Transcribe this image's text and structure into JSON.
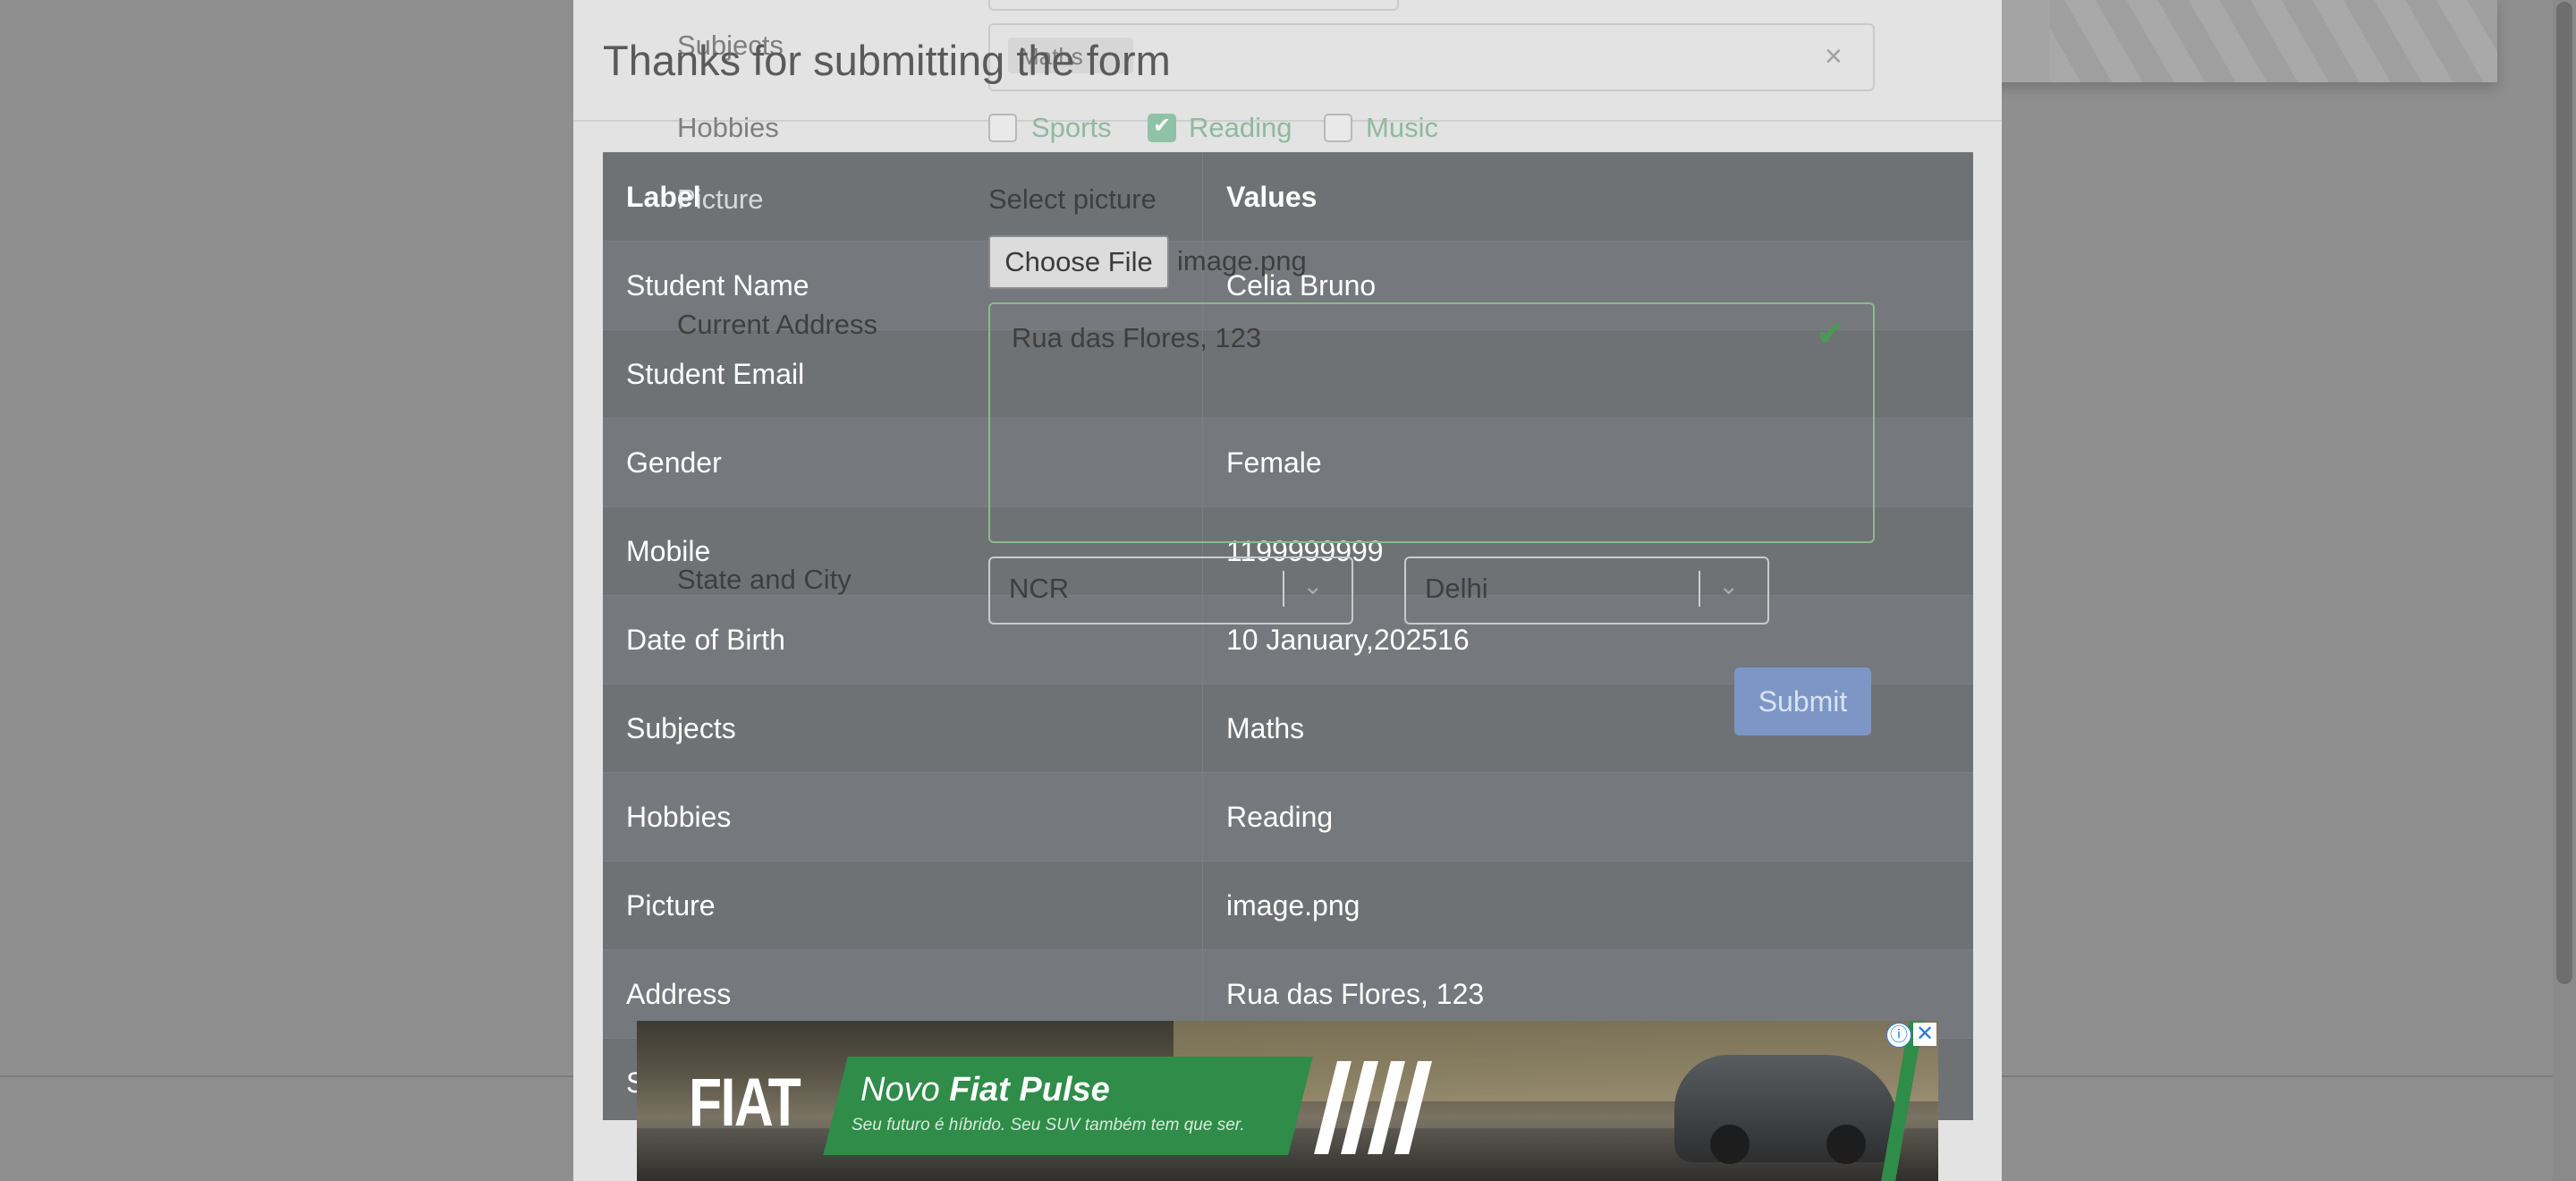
{
  "modal": {
    "title": "Thanks for submitting the form"
  },
  "table": {
    "headers": [
      "Label",
      "Values"
    ],
    "rows": [
      [
        "Student Name",
        "Celia Bruno"
      ],
      [
        "Student Email",
        ""
      ],
      [
        "Gender",
        "Female"
      ],
      [
        "Mobile",
        "1199999999"
      ],
      [
        "Date of Birth",
        "10 January,202516"
      ],
      [
        "Subjects",
        "Maths"
      ],
      [
        "Hobbies",
        "Reading"
      ],
      [
        "Picture",
        "image.png"
      ],
      [
        "Address",
        "Rua das Flores, 123"
      ],
      [
        "S",
        ""
      ]
    ]
  },
  "background_form": {
    "subjects_label": "Subjects",
    "subjects_chip": "Maths",
    "subjects_clear": "×",
    "hobbies_label": "Hobbies",
    "hobbies": [
      {
        "label": "Sports",
        "checked": false
      },
      {
        "label": "Reading",
        "checked": true
      },
      {
        "label": "Music",
        "checked": false
      }
    ],
    "picture_label": "Picture",
    "select_picture": "Select picture",
    "choose_file": "Choose File",
    "file_name": "image.png",
    "current_address_label": "Current Address",
    "current_address_value": "Rua das Flores, 123",
    "state_city_label": "State and City",
    "state_value": "NCR",
    "city_value": "Delhi",
    "submit_label": "Submit"
  },
  "ad": {
    "brand": "FIAT",
    "title_prefix": "Novo ",
    "title_strong": "Fiat Pulse",
    "subtitle": "Seu futuro é híbrido. Seu SUV também tem que ser.",
    "info_icon": "ⓘ",
    "close_icon": "✕"
  },
  "colors": {
    "table_header": "#6f7275",
    "submit": "#7d96c6",
    "ad_green": "#2f8c49"
  }
}
